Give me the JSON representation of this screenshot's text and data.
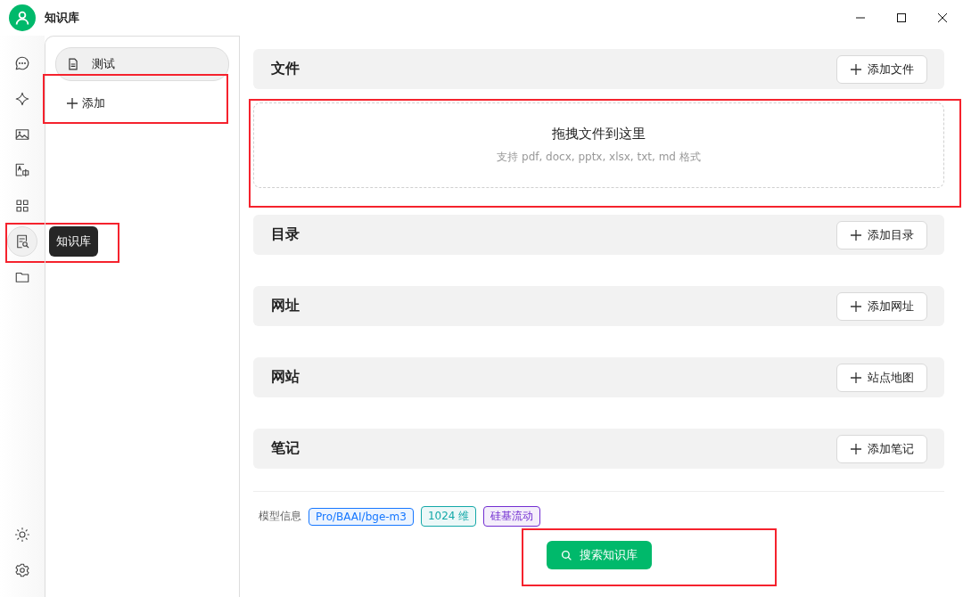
{
  "window": {
    "title": "知识库"
  },
  "rail": {
    "items": [
      {
        "kind": "chat",
        "selected": false
      },
      {
        "kind": "sparkle",
        "selected": false
      },
      {
        "kind": "image",
        "selected": false
      },
      {
        "kind": "translate",
        "selected": false
      },
      {
        "kind": "apps",
        "selected": false
      },
      {
        "kind": "knowledge",
        "selected": true,
        "tooltip": "知识库",
        "highlighted": true
      },
      {
        "kind": "folder",
        "selected": false
      }
    ],
    "bottom_items": [
      {
        "kind": "theme"
      },
      {
        "kind": "settings"
      }
    ]
  },
  "sidebar": {
    "items": [
      {
        "label": "测试",
        "selected": true
      }
    ],
    "add_button": {
      "label": "添加",
      "highlighted": true
    }
  },
  "sections": [
    {
      "title": "文件",
      "button": "添加文件",
      "dropzone": {
        "title": "拖拽文件到这里",
        "hint": "支持 pdf, docx, pptx, xlsx, txt, md 格式",
        "highlighted": true
      }
    },
    {
      "title": "目录",
      "button": "添加目录"
    },
    {
      "title": "网址",
      "button": "添加网址"
    },
    {
      "title": "网站",
      "button": "站点地图"
    },
    {
      "title": "笔记",
      "button": "添加笔记"
    }
  ],
  "model_info": {
    "label": "模型信息",
    "tags": [
      {
        "text": "Pro/BAAI/bge-m3",
        "color": "#1677ff"
      },
      {
        "text": "1024 维",
        "color": "#13a8a8"
      },
      {
        "text": "硅基流动",
        "color": "#722ed1"
      }
    ]
  },
  "search_button": {
    "label": "搜索知识库",
    "highlighted": true
  }
}
